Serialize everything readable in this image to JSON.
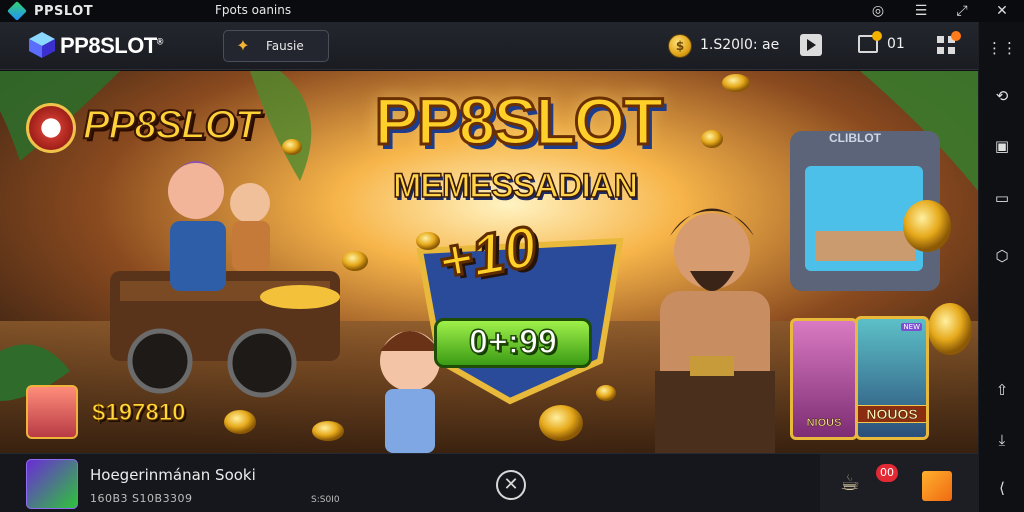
{
  "titlebar": {
    "app_name": "PPSLOT",
    "sub_name": "Fpots oanins",
    "controls": [
      "◎",
      "☰",
      "⤢",
      "✕"
    ]
  },
  "header": {
    "logo": "PP8SLOT",
    "logo_mark": "®",
    "mode_button_label": "Fausie",
    "mode_icon": "game-icon",
    "balance": "1.S20l0: ae",
    "mail_count": "01"
  },
  "banner": {
    "brand_badge": "PP8SLOT",
    "title_main": "PP8SLOT",
    "title_sub": "MEMESSADIAN",
    "multiplier": "+10",
    "odds": "0+:99",
    "arcade_sign": "CLIBLOT",
    "win_amount": "$197810",
    "card1_label": "NIOUS",
    "card2_label": "NOUOS",
    "card2_tag": "NEW"
  },
  "bottombar": {
    "app_title": "Hoegerinmánan Sooki",
    "app_meta": "160B3 S10B3309",
    "app_meta2": "S:S0I0",
    "close_glyph": "✕",
    "notif_badge": "00"
  },
  "sidebar": {
    "buttons": [
      "⋮⋮",
      "⟲",
      "▣",
      "▭",
      "⬡",
      "⇧",
      "⤓",
      "⟨"
    ]
  },
  "colors": {
    "accent_gold": "#ffcf2a",
    "bar_bg": "#1a1c22",
    "notif_red": "#e32933"
  }
}
